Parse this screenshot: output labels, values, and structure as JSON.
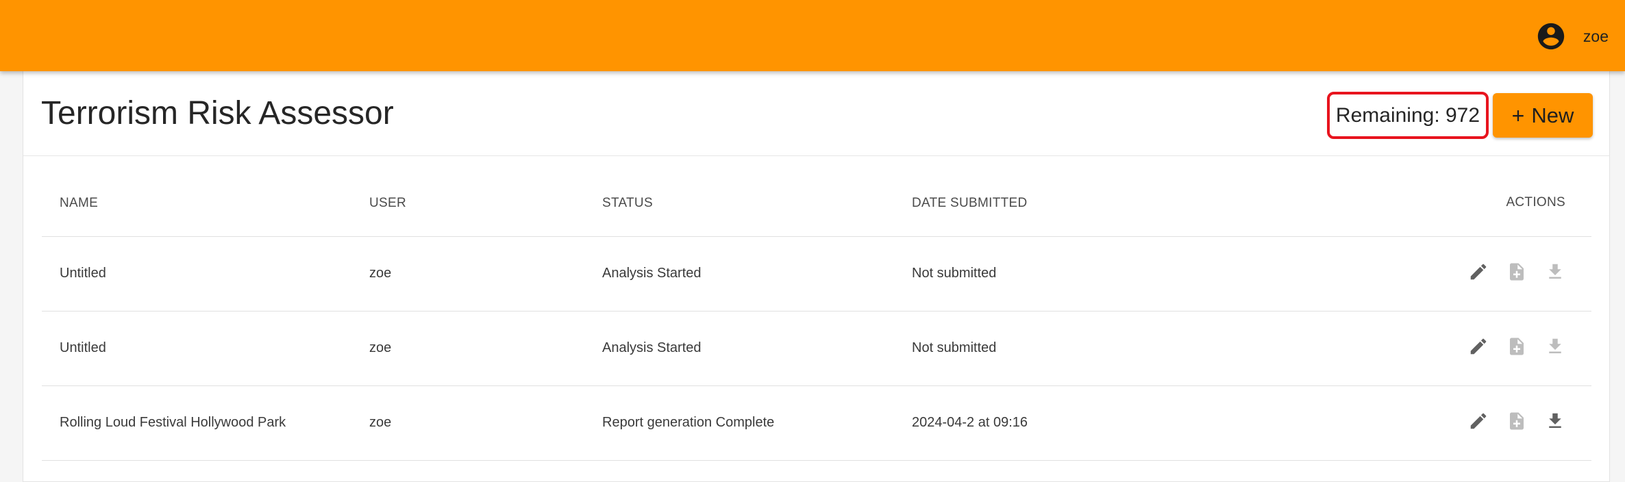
{
  "header": {
    "username": "zoe"
  },
  "page": {
    "title": "Terrorism Risk Assessor",
    "remaining": "Remaining: 972",
    "new_button_plus": "+",
    "new_button_label": "New"
  },
  "table": {
    "columns": [
      "NAME",
      "USER",
      "STATUS",
      "DATE SUBMITTED",
      "ACTIONS"
    ],
    "rows": [
      {
        "name": "Untitled",
        "user": "zoe",
        "status": "Analysis Started",
        "date": "Not submitted",
        "download_enabled": false
      },
      {
        "name": "Untitled",
        "user": "zoe",
        "status": "Analysis Started",
        "date": "Not submitted",
        "download_enabled": false
      },
      {
        "name": "Rolling Loud Festival Hollywood Park",
        "user": "zoe",
        "status": "Report generation Complete",
        "date": "2024-04-2 at 09:16",
        "download_enabled": true
      }
    ]
  },
  "colors": {
    "accent": "#ff9400",
    "highlight_outline": "#e8141e",
    "icon_active": "#616161",
    "icon_disabled": "#bdbdbd"
  },
  "icons": {
    "user": "account-circle-icon",
    "edit": "pencil-icon",
    "report": "file-add-icon",
    "download": "download-icon"
  }
}
